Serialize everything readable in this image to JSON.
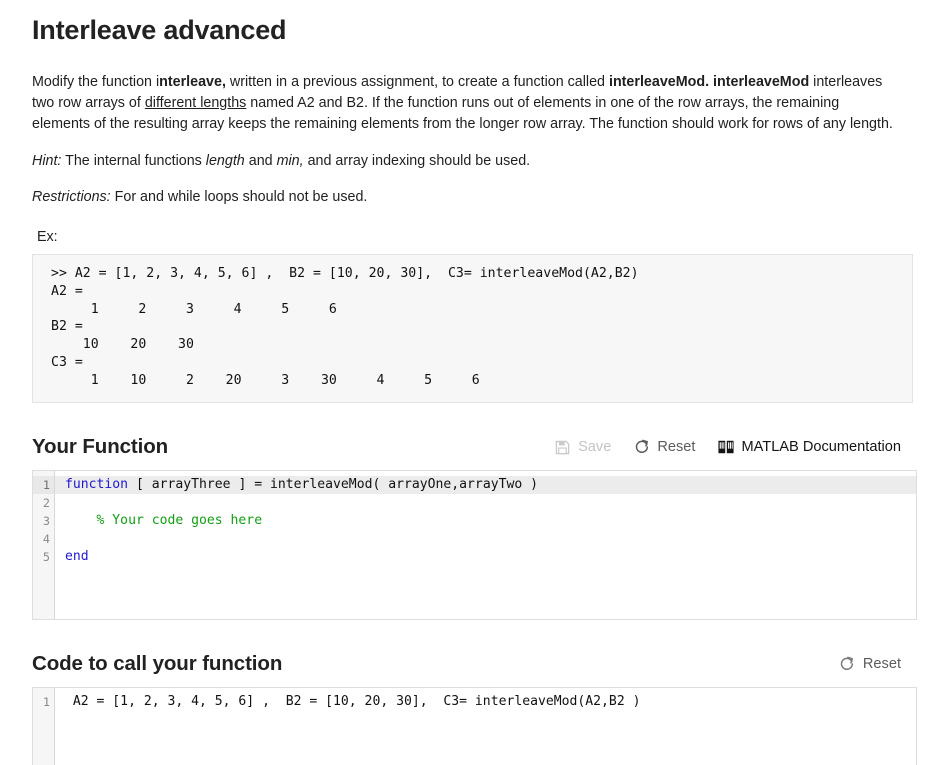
{
  "page": {
    "title": "Interleave advanced",
    "description": {
      "part1": "Modify the function i",
      "bold1": "nterleave,",
      "part2": " written in a previous assignment, to create a function called ",
      "bold2": "interleaveMod. interleaveMod",
      "part3": " interleaves two row arrays of ",
      "underline1": "different lengths",
      "part4": " named A2 and B2. If the function runs out of elements in one of the row arrays, the remaining elements of the resulting array keeps the remaining elements from the longer row array. The function should work for rows of any length."
    },
    "hint": {
      "label": "Hint:",
      "text_a": " The internal functions ",
      "italic_a": "length",
      "text_b": " and ",
      "italic_b": "min,",
      "text_c": " and array indexing should be used."
    },
    "restrictions": {
      "label": "Restrictions:",
      "text": " For and while loops should not be used."
    },
    "example_label": "Ex:",
    "example_output": ">> A2 = [1, 2, 3, 4, 5, 6] ,  B2 = [10, 20, 30],  C3= interleaveMod(A2,B2)\nA2 =\n     1     2     3     4     5     6\nB2 =\n    10    20    30\nC3 =\n     1    10     2    20     3    30     4     5     6"
  },
  "your_function": {
    "title": "Your Function",
    "toolbar": {
      "save_label": "Save",
      "save_icon": "floppy-disk-icon",
      "save_disabled": true,
      "reset_label": "Reset",
      "reset_icon": "refresh-icon",
      "docs_label": "MATLAB Documentation",
      "docs_icon": "book-icon"
    },
    "editor": {
      "line_numbers": [
        "1",
        "2",
        "3",
        "4",
        "5"
      ],
      "active_line": 1,
      "lines": [
        [
          {
            "t": "function",
            "c": "kw"
          },
          {
            "t": " [ arrayThree ] = interleaveMod( arrayOne,arrayTwo )",
            "c": "pl"
          }
        ],
        [],
        [
          {
            "t": "    % Your code goes here",
            "c": "cm"
          }
        ],
        [],
        [
          {
            "t": "end",
            "c": "kw"
          }
        ]
      ]
    }
  },
  "code_to_call": {
    "title": "Code to call your function",
    "toolbar": {
      "reset_label": "Reset",
      "reset_icon": "refresh-icon"
    },
    "editor": {
      "line_numbers": [
        "1"
      ],
      "lines": [
        [
          {
            "t": " A2 = [1, 2, 3, 4, 5, 6] ,  B2 = [10, 20, 30],  C3= interleaveMod(A2,B2 )",
            "c": "pl"
          }
        ]
      ]
    }
  },
  "colors": {
    "keyword": "#1f17d1",
    "comment": "#12a012",
    "panel_bg": "#f7f7f7",
    "active_line": "#ececec",
    "disabled_text": "#c4c4c4"
  }
}
